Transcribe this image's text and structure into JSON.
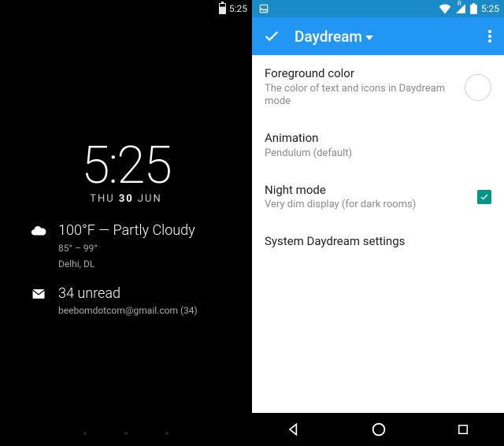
{
  "left": {
    "status_time": "5:25",
    "clock_time": "5:25",
    "date_day": "THU",
    "date_num": "30",
    "date_mon": "JUN",
    "weather": {
      "headline": "100°F — Partly Cloudy",
      "range": "85° – 99°",
      "location": "Delhi,  DL"
    },
    "mail": {
      "headline": "34 unread",
      "account": "beebomdotcom@gmail.com (34)"
    }
  },
  "right": {
    "status_time": "5:25",
    "appbar_title": "Daydream",
    "rows": {
      "fg_color": {
        "title": "Foreground color",
        "subtitle": "The color of text and icons in Daydream mode"
      },
      "animation": {
        "title": "Animation",
        "subtitle": "Pendulum (default)"
      },
      "night_mode": {
        "title": "Night mode",
        "subtitle": "Very dim display (for dark rooms)"
      },
      "system": {
        "title": "System Daydream settings"
      }
    }
  }
}
